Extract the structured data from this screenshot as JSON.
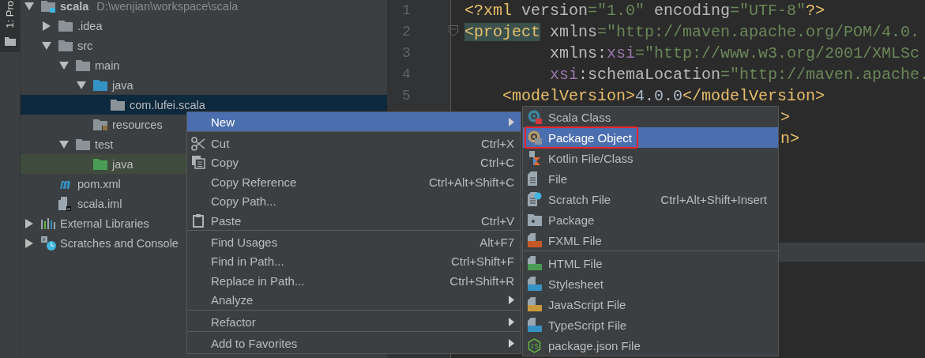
{
  "tool_strip": {
    "tab": "1: Pro"
  },
  "project_tree": {
    "items": [
      {
        "kind": "module",
        "label": "scala",
        "hint": "D:\\wenjian\\workspace\\scala",
        "expanded": true,
        "selected": false,
        "highlighted": false,
        "children": [
          {
            "kind": "folder",
            "label": ".idea",
            "expanded": false,
            "selected": false,
            "highlighted": false
          },
          {
            "kind": "folder",
            "label": "src",
            "expanded": true,
            "selected": false,
            "highlighted": false,
            "children": [
              {
                "kind": "folder",
                "label": "main",
                "expanded": true,
                "selected": false,
                "highlighted": false,
                "children": [
                  {
                    "kind": "source",
                    "label": "java",
                    "expanded": true,
                    "selected": false,
                    "highlighted": false,
                    "children": [
                      {
                        "kind": "package",
                        "label": "com.lufei.scala",
                        "selected": true,
                        "highlighted": false
                      }
                    ]
                  },
                  {
                    "kind": "resources",
                    "label": "resources",
                    "selected": false,
                    "highlighted": false
                  }
                ]
              },
              {
                "kind": "folder",
                "label": "test",
                "expanded": true,
                "selected": false,
                "highlighted": false,
                "children": [
                  {
                    "kind": "test",
                    "label": "java",
                    "selected": false,
                    "highlighted": true
                  }
                ]
              }
            ]
          },
          {
            "kind": "maven",
            "label": "pom.xml",
            "selected": false,
            "highlighted": false
          },
          {
            "kind": "iml",
            "label": "scala.iml",
            "selected": false,
            "highlighted": false
          }
        ]
      },
      {
        "kind": "libraries",
        "label": "External Libraries",
        "expanded": false,
        "selected": false,
        "highlighted": false
      },
      {
        "kind": "scratches",
        "label": "Scratches and Console",
        "expanded": false,
        "selected": false,
        "highlighted": false
      }
    ]
  },
  "editor": {
    "lines": [
      {
        "number": "1",
        "tokens": [
          {
            "kind": "tag",
            "text": "<?xml"
          },
          {
            "kind": "attr",
            "text": " version"
          },
          {
            "kind": "string",
            "text": "=\"1.0\""
          },
          {
            "kind": "attr",
            "text": " encoding"
          },
          {
            "kind": "string",
            "text": "=\"UTF-8\""
          },
          {
            "kind": "tag",
            "text": "?>"
          }
        ]
      },
      {
        "number": "2",
        "tokens": [
          {
            "kind": "match",
            "text": "<project"
          },
          {
            "kind": "attr",
            "text": " xmlns"
          },
          {
            "kind": "string",
            "text": "=\"http://maven.apache.org/POM/4.0."
          }
        ]
      },
      {
        "number": "3",
        "tokens": [
          {
            "kind": "attr",
            "text": "         xmlns:"
          },
          {
            "kind": "ns",
            "text": "xsi"
          },
          {
            "kind": "string",
            "text": "=\"http://www.w3.org/2001/XMLSc"
          }
        ]
      },
      {
        "number": "4",
        "tokens": [
          {
            "kind": "ns",
            "text": "         xsi"
          },
          {
            "kind": "attr",
            "text": ":schemaLocation"
          },
          {
            "kind": "string",
            "text": "=\"http://maven.apache."
          }
        ]
      },
      {
        "number": "5",
        "tokens": [
          {
            "kind": "tag",
            "text": "    <modelVersion>"
          },
          {
            "kind": "text",
            "text": "4.0.0"
          },
          {
            "kind": "tag",
            "text": "</modelVersion>"
          }
        ]
      }
    ],
    "fragments": [
      ">",
      "n>"
    ]
  },
  "context_menu": {
    "items": [
      {
        "label": "New",
        "kind": "plain",
        "submenu": true,
        "selected": true,
        "separator_after": true
      },
      {
        "label": "Cut",
        "shortcut": "Ctrl+X",
        "kind": "cut",
        "submenu": false,
        "selected": false,
        "separator_after": false
      },
      {
        "label": "Copy",
        "shortcut": "Ctrl+C",
        "kind": "copy",
        "submenu": false,
        "selected": false,
        "separator_after": false
      },
      {
        "label": "Copy Reference",
        "shortcut": "Ctrl+Alt+Shift+C",
        "kind": "plain",
        "submenu": false,
        "selected": false,
        "separator_after": false
      },
      {
        "label": "Copy Path...",
        "kind": "plain",
        "submenu": false,
        "selected": false,
        "separator_after": false
      },
      {
        "label": "Paste",
        "shortcut": "Ctrl+V",
        "kind": "paste",
        "submenu": false,
        "selected": false,
        "separator_after": true
      },
      {
        "label": "Find Usages",
        "shortcut": "Alt+F7",
        "kind": "plain",
        "submenu": false,
        "selected": false,
        "separator_after": false
      },
      {
        "label": "Find in Path...",
        "shortcut": "Ctrl+Shift+F",
        "kind": "plain",
        "submenu": false,
        "selected": false,
        "separator_after": false
      },
      {
        "label": "Replace in Path...",
        "shortcut": "Ctrl+Shift+R",
        "kind": "plain",
        "submenu": false,
        "selected": false,
        "separator_after": false
      },
      {
        "label": "Analyze",
        "kind": "plain",
        "submenu": true,
        "selected": false,
        "separator_after": true
      },
      {
        "label": "Refactor",
        "kind": "plain",
        "submenu": true,
        "selected": false,
        "separator_after": true
      },
      {
        "label": "Add to Favorites",
        "kind": "plain",
        "submenu": true,
        "selected": false,
        "separator_after": false
      }
    ]
  },
  "new_submenu": {
    "items": [
      {
        "label": "Scala Class",
        "kind": "scala",
        "selected": false,
        "outlined": false,
        "separator_after": false
      },
      {
        "label": "Package Object",
        "kind": "package-object",
        "selected": true,
        "outlined": true,
        "separator_after": false
      },
      {
        "label": "Kotlin File/Class",
        "kind": "kotlin",
        "selected": false,
        "outlined": false,
        "separator_after": false
      },
      {
        "label": "File",
        "kind": "file",
        "selected": false,
        "outlined": false,
        "separator_after": false
      },
      {
        "label": "Scratch File",
        "shortcut": "Ctrl+Alt+Shift+Insert",
        "kind": "scratch",
        "selected": false,
        "outlined": false,
        "separator_after": false
      },
      {
        "label": "Package",
        "kind": "package",
        "selected": false,
        "outlined": false,
        "separator_after": false
      },
      {
        "label": "FXML File",
        "kind": "fxml",
        "selected": false,
        "outlined": false,
        "separator_after": true
      },
      {
        "label": "HTML File",
        "kind": "html",
        "selected": false,
        "outlined": false,
        "separator_after": false
      },
      {
        "label": "Stylesheet",
        "kind": "css",
        "selected": false,
        "outlined": false,
        "separator_after": false
      },
      {
        "label": "JavaScript File",
        "kind": "js",
        "selected": false,
        "outlined": false,
        "separator_after": false
      },
      {
        "label": "TypeScript File",
        "kind": "ts",
        "selected": false,
        "outlined": false,
        "separator_after": false
      },
      {
        "label": "package.json File",
        "kind": "node",
        "selected": false,
        "outlined": false,
        "separator_after": false
      }
    ]
  }
}
